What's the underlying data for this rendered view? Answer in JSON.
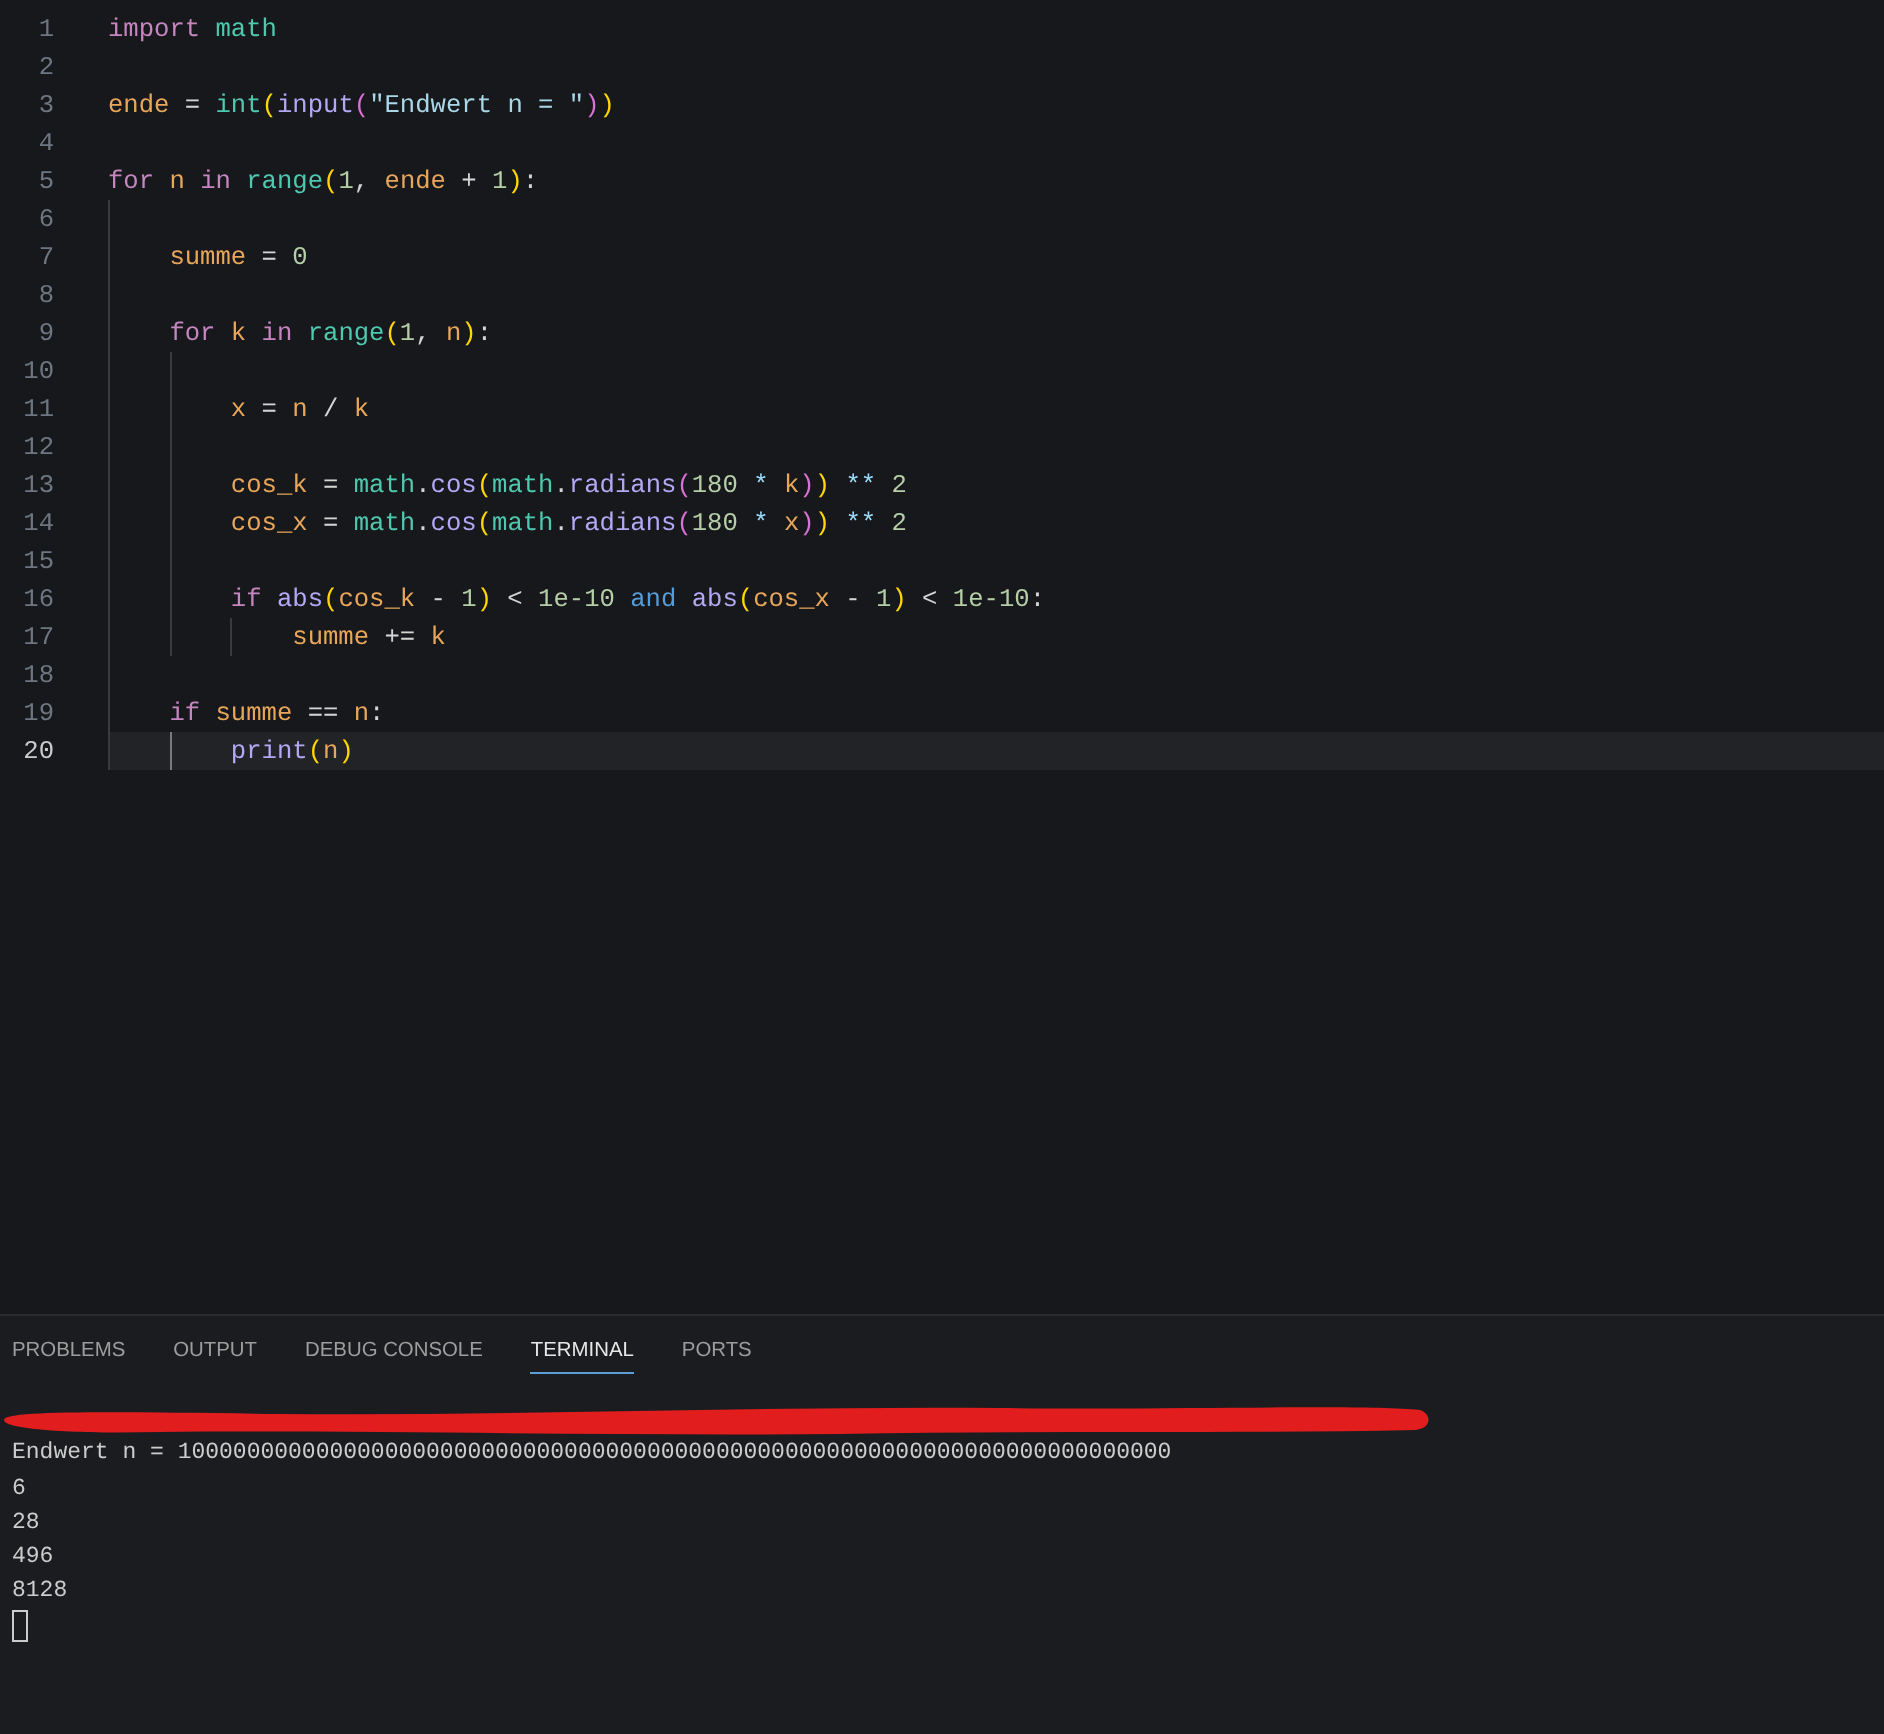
{
  "editor": {
    "lines": [
      {
        "number": "1",
        "active": false,
        "tokens": [
          {
            "text": "import",
            "kind": "keyword"
          },
          {
            "text": " math",
            "kind": "module"
          }
        ]
      },
      {
        "number": "2",
        "active": false
      },
      {
        "number": "3",
        "active": false,
        "tokens": [
          {
            "text": "ende",
            "kind": "variable"
          },
          {
            "text": " =",
            "kind": "operator"
          },
          {
            "text": " int",
            "kind": "type"
          },
          {
            "text": "(",
            "kind": "open"
          },
          {
            "text": "input",
            "kind": "func"
          },
          {
            "text": "(",
            "kind": "open"
          },
          {
            "text": "\"Endwert n = \"",
            "kind": "string"
          },
          {
            "text": ")",
            "kind": "close"
          },
          {
            "text": ")",
            "kind": "close"
          }
        ]
      },
      {
        "number": "4",
        "active": false
      },
      {
        "number": "5",
        "active": false,
        "tokens": [
          {
            "text": "for",
            "kind": "keyword"
          },
          {
            "text": " n",
            "kind": "variable"
          },
          {
            "text": " in",
            "kind": "keyword"
          },
          {
            "text": " range",
            "kind": "type"
          },
          {
            "text": "(",
            "kind": "open"
          },
          {
            "text": "1",
            "kind": "number"
          },
          {
            "text": ",",
            "kind": "punct"
          },
          {
            "text": " ende",
            "kind": "variable"
          },
          {
            "text": " +",
            "kind": "operator"
          },
          {
            "text": " 1",
            "kind": "number"
          },
          {
            "text": ")",
            "kind": "close"
          },
          {
            "text": ":",
            "kind": "punct"
          }
        ],
        "children": [
          {
            "number": "6",
            "active": false
          },
          {
            "number": "7",
            "active": false,
            "tokens": [
              {
                "text": "summe",
                "kind": "variable"
              },
              {
                "text": " =",
                "kind": "operator"
              },
              {
                "text": " 0",
                "kind": "number"
              }
            ]
          },
          {
            "number": "8",
            "active": false
          },
          {
            "number": "9",
            "active": false,
            "tokens": [
              {
                "text": "for",
                "kind": "keyword"
              },
              {
                "text": " k",
                "kind": "variable"
              },
              {
                "text": " in",
                "kind": "keyword"
              },
              {
                "text": " range",
                "kind": "type"
              },
              {
                "text": "(",
                "kind": "open"
              },
              {
                "text": "1",
                "kind": "number"
              },
              {
                "text": ",",
                "kind": "punct"
              },
              {
                "text": " n",
                "kind": "variable"
              },
              {
                "text": ")",
                "kind": "close"
              },
              {
                "text": ":",
                "kind": "punct"
              }
            ],
            "children": [
              {
                "number": "10",
                "active": false
              },
              {
                "number": "11",
                "active": false,
                "tokens": [
                  {
                    "text": "x",
                    "kind": "variable"
                  },
                  {
                    "text": " =",
                    "kind": "operator"
                  },
                  {
                    "text": " n",
                    "kind": "variable"
                  },
                  {
                    "text": " /",
                    "kind": "operator"
                  },
                  {
                    "text": " k",
                    "kind": "variable"
                  }
                ]
              },
              {
                "number": "12",
                "active": false
              },
              {
                "number": "13",
                "active": false,
                "tokens": [
                  {
                    "text": "cos_k",
                    "kind": "variable"
                  },
                  {
                    "text": " =",
                    "kind": "operator"
                  },
                  {
                    "text": " math",
                    "kind": "module"
                  },
                  {
                    "text": ".",
                    "kind": "punct"
                  },
                  {
                    "text": "cos",
                    "kind": "func"
                  },
                  {
                    "text": "(",
                    "kind": "open"
                  },
                  {
                    "text": "math",
                    "kind": "module"
                  },
                  {
                    "text": ".",
                    "kind": "punct"
                  },
                  {
                    "text": "radians",
                    "kind": "func"
                  },
                  {
                    "text": "(",
                    "kind": "open"
                  },
                  {
                    "text": "180",
                    "kind": "number"
                  },
                  {
                    "text": " *",
                    "kind": "arith"
                  },
                  {
                    "text": " k",
                    "kind": "variable"
                  },
                  {
                    "text": ")",
                    "kind": "close"
                  },
                  {
                    "text": ")",
                    "kind": "close"
                  },
                  {
                    "text": " **",
                    "kind": "arith"
                  },
                  {
                    "text": " 2",
                    "kind": "number"
                  }
                ]
              },
              {
                "number": "14",
                "active": false,
                "tokens": [
                  {
                    "text": "cos_x",
                    "kind": "variable"
                  },
                  {
                    "text": " =",
                    "kind": "operator"
                  },
                  {
                    "text": " math",
                    "kind": "module"
                  },
                  {
                    "text": ".",
                    "kind": "punct"
                  },
                  {
                    "text": "cos",
                    "kind": "func"
                  },
                  {
                    "text": "(",
                    "kind": "open"
                  },
                  {
                    "text": "math",
                    "kind": "module"
                  },
                  {
                    "text": ".",
                    "kind": "punct"
                  },
                  {
                    "text": "radians",
                    "kind": "func"
                  },
                  {
                    "text": "(",
                    "kind": "open"
                  },
                  {
                    "text": "180",
                    "kind": "number"
                  },
                  {
                    "text": " *",
                    "kind": "arith"
                  },
                  {
                    "text": " x",
                    "kind": "variable"
                  },
                  {
                    "text": ")",
                    "kind": "close"
                  },
                  {
                    "text": ")",
                    "kind": "close"
                  },
                  {
                    "text": " **",
                    "kind": "arith"
                  },
                  {
                    "text": " 2",
                    "kind": "number"
                  }
                ]
              },
              {
                "number": "15",
                "active": false
              },
              {
                "number": "16",
                "active": false,
                "tokens": [
                  {
                    "text": "if",
                    "kind": "keyword"
                  },
                  {
                    "text": " abs",
                    "kind": "func"
                  },
                  {
                    "text": "(",
                    "kind": "open"
                  },
                  {
                    "text": "cos_k",
                    "kind": "variable"
                  },
                  {
                    "text": " -",
                    "kind": "operator"
                  },
                  {
                    "text": " 1",
                    "kind": "number"
                  },
                  {
                    "text": ")",
                    "kind": "close"
                  },
                  {
                    "text": " <",
                    "kind": "operator"
                  },
                  {
                    "text": " 1e-10",
                    "kind": "number"
                  },
                  {
                    "text": " and",
                    "kind": "logic"
                  },
                  {
                    "text": " abs",
                    "kind": "func"
                  },
                  {
                    "text": "(",
                    "kind": "open"
                  },
                  {
                    "text": "cos_x",
                    "kind": "variable"
                  },
                  {
                    "text": " -",
                    "kind": "operator"
                  },
                  {
                    "text": " 1",
                    "kind": "number"
                  },
                  {
                    "text": ")",
                    "kind": "close"
                  },
                  {
                    "text": " <",
                    "kind": "operator"
                  },
                  {
                    "text": " 1e-10",
                    "kind": "number"
                  },
                  {
                    "text": ":",
                    "kind": "punct"
                  }
                ],
                "children": [
                  {
                    "number": "17",
                    "active": false,
                    "tokens": [
                      {
                        "text": "summe",
                        "kind": "variable"
                      },
                      {
                        "text": " +=",
                        "kind": "operator"
                      },
                      {
                        "text": " k",
                        "kind": "variable"
                      }
                    ]
                  }
                ]
              }
            ]
          },
          {
            "number": "18",
            "active": false
          },
          {
            "number": "19",
            "active": false,
            "tokens": [
              {
                "text": "if",
                "kind": "keyword"
              },
              {
                "text": " summe",
                "kind": "variable"
              },
              {
                "text": " ==",
                "kind": "operator"
              },
              {
                "text": " n",
                "kind": "variable"
              },
              {
                "text": ":",
                "kind": "punct"
              }
            ],
            "children": [
              {
                "number": "20",
                "active": true,
                "tokens": [
                  {
                    "text": "print",
                    "kind": "func"
                  },
                  {
                    "text": "(",
                    "kind": "open"
                  },
                  {
                    "text": "n",
                    "kind": "variable"
                  },
                  {
                    "text": ")",
                    "kind": "close"
                  }
                ]
              }
            ]
          }
        ]
      }
    ]
  },
  "panel": {
    "tabs": [
      {
        "label": "PROBLEMS",
        "selected": false
      },
      {
        "label": "OUTPUT",
        "selected": false
      },
      {
        "label": "DEBUG CONSOLE",
        "selected": false
      },
      {
        "label": "TERMINAL",
        "selected": true
      },
      {
        "label": "PORTS",
        "selected": false
      }
    ],
    "terminal": {
      "lines": [
        "Endwert n = 100000000000000000000000000000000000000000000000000000000000000000000000",
        "6",
        "28",
        "496",
        "8128"
      ]
    }
  }
}
